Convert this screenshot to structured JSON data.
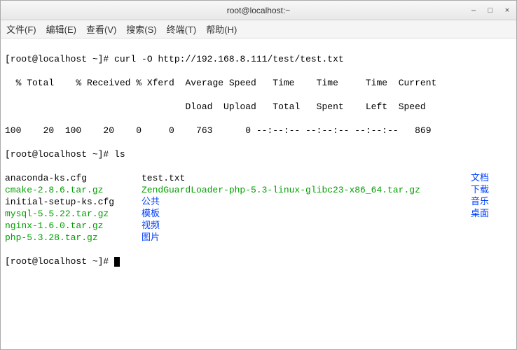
{
  "window": {
    "title": "root@localhost:~"
  },
  "menu": {
    "file": "文件(F)",
    "edit": "编辑(E)",
    "view": "查看(V)",
    "search": "搜索(S)",
    "terminal": "终端(T)",
    "help": "帮助(H)"
  },
  "term": {
    "prompt": "[root@localhost ~]# ",
    "cmd_curl": "curl -O http://192.168.8.111/test/test.txt",
    "curl_header": "  % Total    % Received % Xferd  Average Speed   Time    Time     Time  Current",
    "curl_header2": "                                 Dload  Upload   Total   Spent    Left  Speed",
    "curl_progress": "100    20  100    20    0     0    763      0 --:--:-- --:--:-- --:--:--   869",
    "cmd_ls": "ls",
    "ls_rows": [
      {
        "c1": {
          "t": "anaconda-ks.cfg",
          "cls": ""
        },
        "c2": {
          "t": "test.txt",
          "cls": ""
        },
        "c3": {
          "t": "文档",
          "cls": "blue"
        }
      },
      {
        "c1": {
          "t": "cmake-2.8.6.tar.gz",
          "cls": "green"
        },
        "c2": {
          "t": "ZendGuardLoader-php-5.3-linux-glibc23-x86_64.tar.gz",
          "cls": "green"
        },
        "c3": {
          "t": "下载",
          "cls": "blue"
        }
      },
      {
        "c1": {
          "t": "initial-setup-ks.cfg",
          "cls": ""
        },
        "c2": {
          "t": "公共",
          "cls": "blue"
        },
        "c3": {
          "t": "音乐",
          "cls": "blue"
        }
      },
      {
        "c1": {
          "t": "mysql-5.5.22.tar.gz",
          "cls": "green"
        },
        "c2": {
          "t": "模板",
          "cls": "blue"
        },
        "c3": {
          "t": "桌面",
          "cls": "blue"
        }
      },
      {
        "c1": {
          "t": "nginx-1.6.0.tar.gz",
          "cls": "green"
        },
        "c2": {
          "t": "视频",
          "cls": "blue"
        },
        "c3": {
          "t": "",
          "cls": ""
        }
      },
      {
        "c1": {
          "t": "php-5.3.28.tar.gz",
          "cls": "green"
        },
        "c2": {
          "t": "图片",
          "cls": "blue"
        },
        "c3": {
          "t": "",
          "cls": ""
        }
      }
    ]
  }
}
